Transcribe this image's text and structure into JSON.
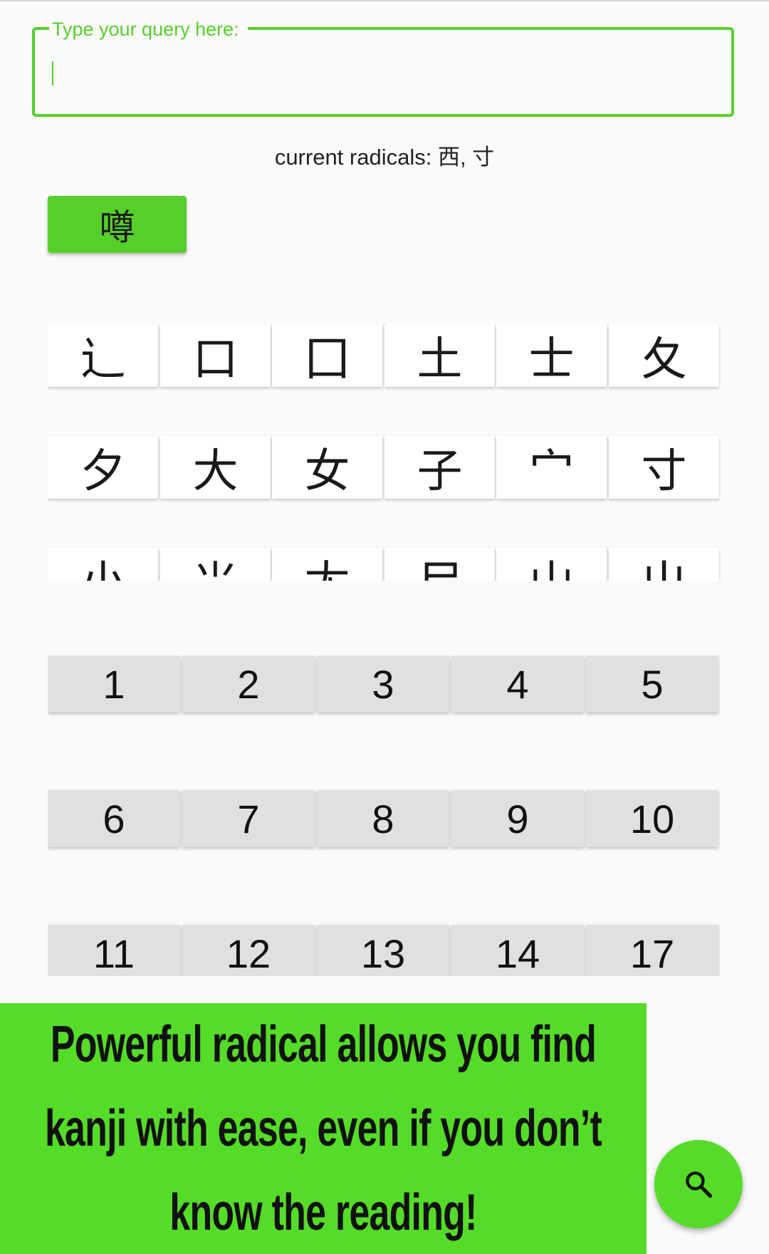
{
  "query": {
    "label": "Type your query here:",
    "value": "",
    "placeholder": ""
  },
  "current_radicals": {
    "text": "current radicals: 西, 寸"
  },
  "results": [
    "噂"
  ],
  "radicals": [
    [
      "辶",
      "口",
      "囗",
      "土",
      "士",
      "夂"
    ],
    [
      "夕",
      "大",
      "女",
      "子",
      "宀",
      "寸"
    ],
    [
      "小",
      "⺌",
      "尢",
      "尸",
      "山",
      "屮"
    ]
  ],
  "stroke_counts": [
    [
      "1",
      "2",
      "3",
      "4",
      "5"
    ],
    [
      "6",
      "7",
      "8",
      "9",
      "10"
    ],
    [
      "11",
      "12",
      "13",
      "14",
      "17"
    ]
  ],
  "banner": {
    "line1": "Powerful radical allows you find",
    "line2": "kanji with ease, even if you don’t",
    "line3": "know the reading!"
  },
  "fab": {
    "icon": "search-icon"
  },
  "colors": {
    "accent": "#55d02a",
    "banner": "#55dc28",
    "background": "#fafafa",
    "stroke_button": "#e0e0e0"
  }
}
